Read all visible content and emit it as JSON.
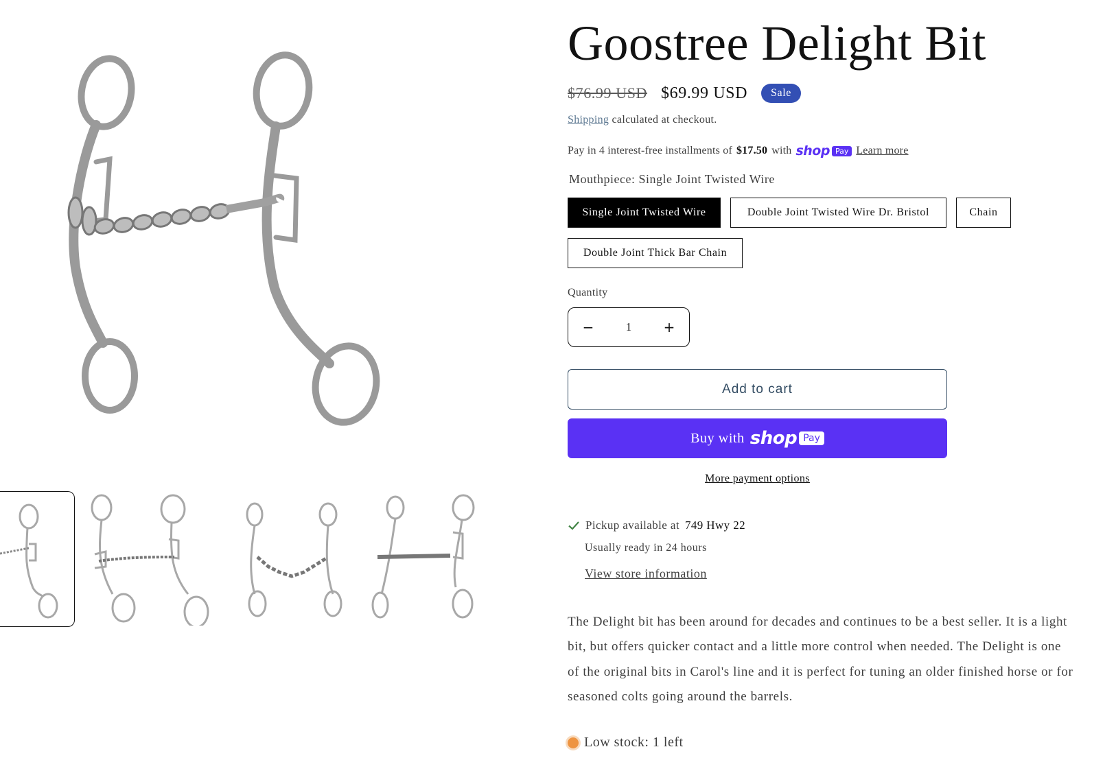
{
  "product": {
    "title": "Goostree Delight Bit",
    "price_compare": "$76.99 USD",
    "price_sale": "$69.99 USD",
    "sale_badge": "Sale"
  },
  "shipping": {
    "link": "Shipping",
    "text": "calculated at checkout."
  },
  "installments": {
    "prefix": "Pay in 4 interest-free installments of",
    "amount": "$17.50",
    "with": "with",
    "shop_text": "shop",
    "pay_text": "Pay",
    "learn_more": "Learn more"
  },
  "variant": {
    "label": "Mouthpiece: Single Joint Twisted Wire",
    "options": [
      "Single Joint Twisted Wire",
      "Double Joint Twisted Wire Dr. Bristol",
      "Chain",
      "Double Joint Thick Bar Chain"
    ],
    "selected_index": 0
  },
  "quantity": {
    "label": "Quantity",
    "value": "1",
    "decrease": "−",
    "increase": "+"
  },
  "buttons": {
    "add_to_cart": "Add to cart",
    "buy_with": "Buy with",
    "shop_text": "shop",
    "pay_text": "Pay",
    "more_payment": "More payment options"
  },
  "pickup": {
    "prefix": "Pickup available at",
    "location": "749 Hwy 22",
    "ready": "Usually ready in 24 hours",
    "store_link": "View store information"
  },
  "description": "The Delight bit has been around for decades and continues to be a best seller. It is a light bit, but offers quicker contact and a little more control when needed. The Delight is one of the original bits in Carol's line and it is perfect for tuning an older finished horse or for seasoned colts going around the barrels.",
  "stock": {
    "text": "Low stock: 1 left"
  },
  "colors": {
    "brand_shop": "#5a31f4",
    "sale_badge": "#334fb4",
    "check": "#428445",
    "stock_dot": "#ee9441"
  },
  "icons": [
    "check-icon",
    "stock-dot-icon",
    "shop-pay-logo"
  ]
}
